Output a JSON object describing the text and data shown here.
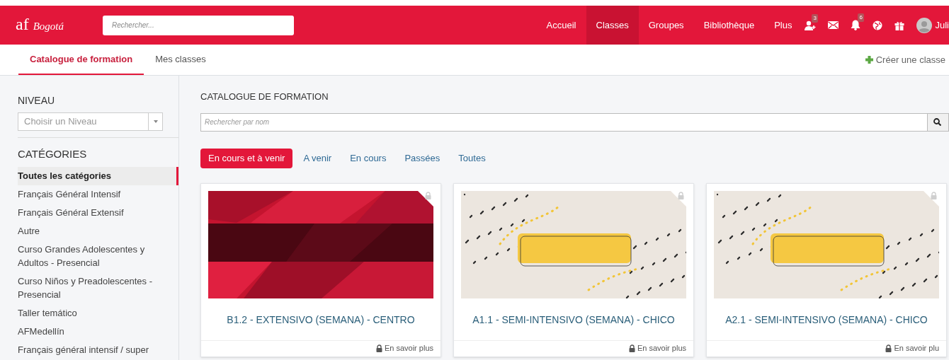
{
  "brand": {
    "mark": "af",
    "city": "Bogotá"
  },
  "top_search": {
    "placeholder": "Rechercher..."
  },
  "nav": [
    {
      "label": "Accueil",
      "selected": false
    },
    {
      "label": "Classes",
      "selected": true
    },
    {
      "label": "Groupes",
      "selected": false
    },
    {
      "label": "Bibliothèque",
      "selected": false
    },
    {
      "label": "Plus",
      "selected": false
    }
  ],
  "nav_icons": [
    {
      "kind": "add-user",
      "badge": "3"
    },
    {
      "kind": "mail"
    },
    {
      "kind": "bell",
      "badge": "6"
    },
    {
      "kind": "globe"
    },
    {
      "kind": "gift"
    }
  ],
  "user": {
    "name": "Juli"
  },
  "subtabs": [
    {
      "label": "Catalogue de formation",
      "selected": true
    },
    {
      "label": "Mes classes",
      "selected": false
    }
  ],
  "create_button": "Créer une classe",
  "sidebar": {
    "niveau_title": "NIVEAU",
    "niveau_select": {
      "placeholder": "Choisir un Niveau"
    },
    "categories_title": "CATÉGORIES",
    "categories": [
      {
        "label": "Toutes les catégories",
        "selected": true
      },
      {
        "label": "Français Général Intensif",
        "selected": false
      },
      {
        "label": "Français Général Extensif",
        "selected": false
      },
      {
        "label": "Autre",
        "selected": false
      },
      {
        "label": "Curso Grandes Adolescentes y Adultos - Presencial",
        "selected": false
      },
      {
        "label": "Curso Niños y Preadolescentes - Presencial",
        "selected": false
      },
      {
        "label": "Taller temático",
        "selected": false
      },
      {
        "label": "AFMedellín",
        "selected": false
      },
      {
        "label": "Français général intensif / super",
        "selected": false
      }
    ]
  },
  "main": {
    "title": "CATALOGUE DE FORMATION",
    "search": {
      "placeholder": "Rechercher par nom"
    },
    "filters": [
      {
        "label": "En cours et à venir",
        "selected": true
      },
      {
        "label": "A venir",
        "selected": false
      },
      {
        "label": "En cours",
        "selected": false
      },
      {
        "label": "Passées",
        "selected": false
      },
      {
        "label": "Toutes",
        "selected": false
      }
    ],
    "cards": [
      {
        "title": "B1.2 - EXTENSIVO (SEMANA) - CENTRO",
        "link": "En savoir plus",
        "kind": "picture"
      },
      {
        "title": "A1.1 - SEMI-INTENSIVO (SEMANA) - CHICO",
        "link": "En savoir plus",
        "kind": "picture"
      },
      {
        "title": "A2.1 - SEMI-INTENSIVO (SEMANA) - CHICO",
        "link": "En savoir plu",
        "kind": "picture"
      }
    ]
  }
}
